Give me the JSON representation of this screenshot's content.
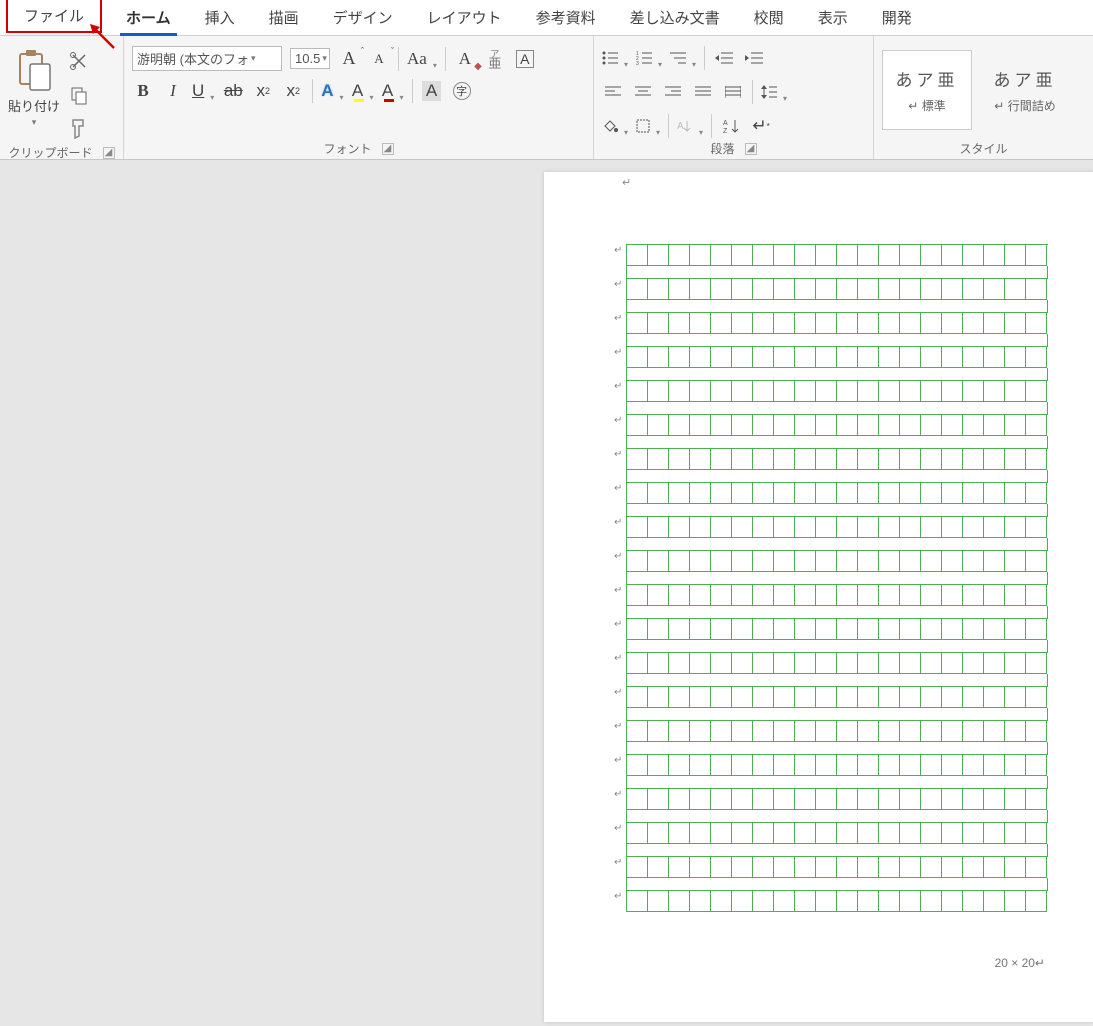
{
  "tabs": {
    "file": "ファイル",
    "home": "ホーム",
    "insert": "挿入",
    "draw": "描画",
    "design": "デザイン",
    "layout": "レイアウト",
    "references": "参考資料",
    "mailings": "差し込み文書",
    "review": "校閲",
    "view": "表示",
    "developer": "開発"
  },
  "ribbon": {
    "clipboard": {
      "title": "クリップボード",
      "paste": "貼り付け"
    },
    "font": {
      "title": "フォント",
      "name": "游明朝 (本文のフォ",
      "size": "10.5",
      "ruby_label": "ア\n亜",
      "bold": "B",
      "italic": "I",
      "underline": "U",
      "strike": "ab",
      "sub": "x",
      "sup": "x",
      "effects": "A",
      "highlight": "A",
      "color": "A",
      "shade": "A",
      "enclose": "字"
    },
    "paragraph": {
      "title": "段落"
    },
    "styles": {
      "title": "スタイル",
      "preview": "あア亜",
      "normal": "標準",
      "nospace": "行間詰め",
      "arrow": "↵"
    }
  },
  "document": {
    "grid": {
      "rows": 20,
      "cols": 20,
      "caption": "20 × 20↵"
    },
    "para_mark": "↵"
  }
}
